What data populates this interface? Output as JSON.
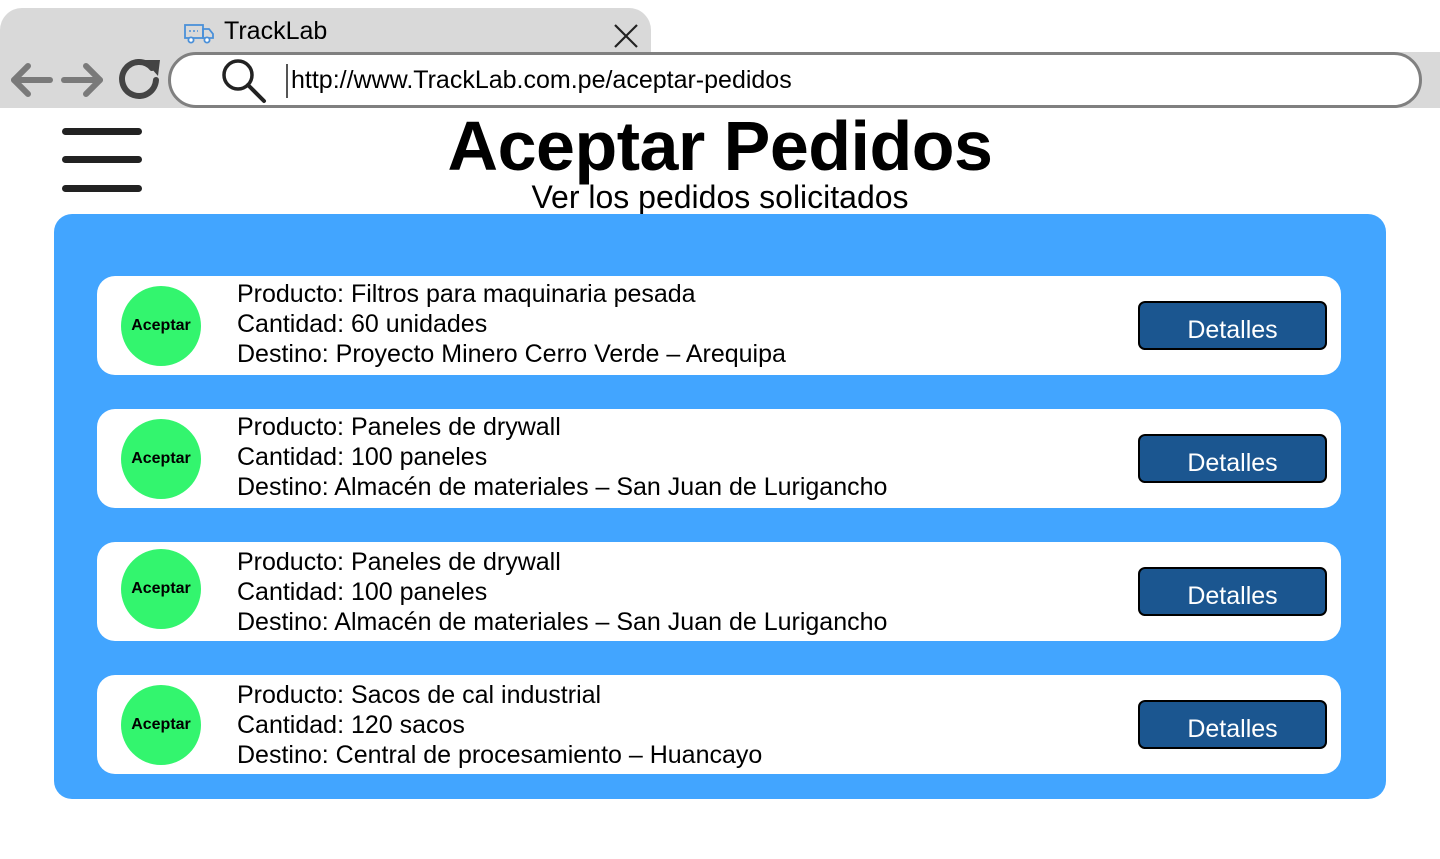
{
  "browser": {
    "tab_title": "TrackLab",
    "url": "http://www.TrackLab.com.pe/aceptar-pedidos",
    "icons": {
      "tab": "truck-icon",
      "close": "close-icon",
      "back": "arrow-left-icon",
      "forward": "arrow-right-icon",
      "reload": "reload-icon",
      "search": "search-icon"
    }
  },
  "header": {
    "menu_icon": "hamburger-menu-icon",
    "title": "Aceptar Pedidos",
    "subtitle": "Ver los pedidos solicitados"
  },
  "colors": {
    "panel": "#42a5ff",
    "accept": "#33f56e",
    "details": "#1b5690"
  },
  "orders": [
    {
      "accept_label": "Aceptar",
      "product": "Producto: Filtros para maquinaria pesada",
      "quantity": "Cantidad: 60 unidades",
      "destination": "Destino: Proyecto Minero Cerro Verde – Arequipa",
      "details_label": "Detalles"
    },
    {
      "accept_label": "Aceptar",
      "product": "Producto: Paneles de drywall",
      "quantity": "Cantidad: 100 paneles",
      "destination": "Destino: Almacén de materiales – San Juan de Lurigancho",
      "details_label": "Detalles"
    },
    {
      "accept_label": "Aceptar",
      "product": "Producto: Paneles de drywall",
      "quantity": "Cantidad: 100 paneles",
      "destination": "Destino: Almacén de materiales – San Juan de Lurigancho",
      "details_label": "Detalles"
    },
    {
      "accept_label": "Aceptar",
      "product": "Producto: Sacos de cal industrial",
      "quantity": "Cantidad: 120 sacos",
      "destination": "Destino: Central de procesamiento – Huancayo",
      "details_label": "Detalles"
    }
  ]
}
